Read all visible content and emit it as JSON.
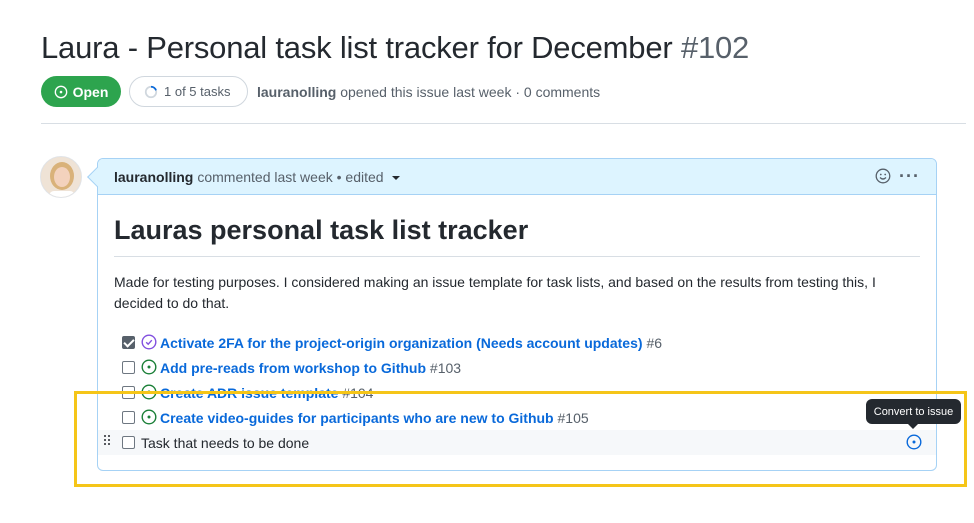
{
  "issue": {
    "title": "Laura - Personal task list tracker for December",
    "number": "#102",
    "state": "Open",
    "tasks_progress": "1 of 5 tasks",
    "author": "lauranolling",
    "meta_text": "opened this issue last week · 0 comments"
  },
  "comment": {
    "author": "lauranolling",
    "meta": "commented last week • edited",
    "heading": "Lauras personal task list tracker",
    "description": "Made for testing purposes. I considered making an issue template for task lists, and based on the results from testing this, I decided to do that."
  },
  "tasks": [
    {
      "text": "Activate 2FA for the project-origin organization (Needs account updates)",
      "ref": "#6",
      "checked": true,
      "status": "closed"
    },
    {
      "text": "Add pre-reads from workshop to Github",
      "ref": "#103",
      "checked": false,
      "status": "open"
    },
    {
      "text": "Create ADR issue template",
      "ref": "#104",
      "checked": false,
      "status": "open"
    },
    {
      "text": "Create video-guides for participants who are new to Github",
      "ref": "#105",
      "checked": false,
      "status": "open"
    },
    {
      "text": "Task that needs to be done",
      "ref": "",
      "checked": false,
      "status": "draft"
    }
  ],
  "tooltip": "Convert to issue",
  "colors": {
    "open_green": "#2da44e",
    "link_blue": "#0969da",
    "closed_purple": "#8250df",
    "header_bg": "#ddf4ff",
    "highlight": "#f5c518"
  },
  "icons": {
    "state": "issue-opened-icon",
    "progress": "progress-ring-icon",
    "emoji": "smiley-icon",
    "more": "kebab-horizontal-icon",
    "drag": "grabber-icon"
  }
}
